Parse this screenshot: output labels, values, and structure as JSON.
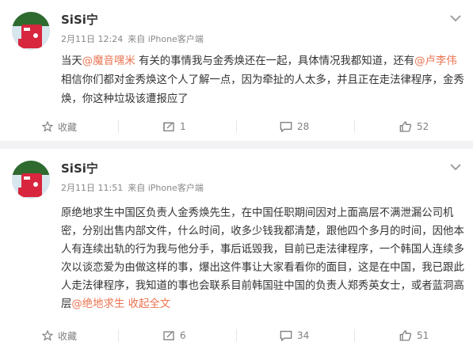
{
  "posts": [
    {
      "username": "SiSi宁",
      "date": "2月11日 12:24",
      "source": "来自 iPhone客户端",
      "content": {
        "p1": "当天",
        "m1": "@魔音嘿米",
        "p2": " 有关的事情我与金秀焕还在一起，具体情况我都知道，还有",
        "m2": "@卢李伟",
        "p3": " 相信你们都对金秀焕这个人了解一点，因为牵扯的人太多，并且正在走法律程序，金秀焕，你这种垃圾该遭报应了"
      },
      "actions": {
        "favorite": "收藏",
        "repost": "1",
        "comment": "28",
        "like": "52"
      }
    },
    {
      "username": "SiSi宁",
      "date": "2月11日 11:51",
      "source": "来自 iPhone客户端",
      "content": {
        "p1": "原绝地求生中国区负责人金秀焕先生，在中国任职期间因对上面高层不满泄漏公司机密，分别出售内部文件，什么时间，收多少钱我都清楚，跟他四个多月的时间，因他本人有连续出轨的行为我与他分手，事后诋毁我，目前已走法律程序，一个韩国人连续多次以谈恋爱为由做这样的事，爆出这件事让大家看看你的面目，这是在中国，我已跟此人走法律程序，我知道的事也会联系目前韩国驻中国的负责人郑秀英女士，或者蓝洞高层",
        "m1": "@绝地求生",
        "more": " 收起全文"
      },
      "actions": {
        "favorite": "收藏",
        "repost": "6",
        "comment": "34",
        "like": "51"
      }
    }
  ],
  "colors": {
    "mention": "#eb7350",
    "text": "#333333",
    "meta": "#888888"
  },
  "icons": [
    "avatar",
    "chevron-down-icon",
    "star-icon",
    "repost-icon",
    "comment-icon",
    "thumbs-up-icon"
  ]
}
